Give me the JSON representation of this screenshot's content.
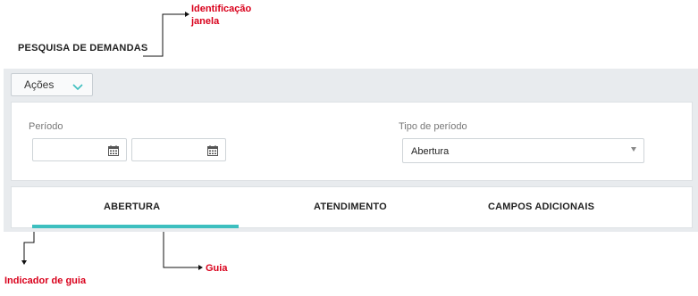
{
  "annotations": {
    "window_id": [
      "Identificação",
      "janela"
    ],
    "tab_indicator": "Indicador de guia",
    "tab": "Guia"
  },
  "page": {
    "title": "PESQUISA DE DEMANDAS"
  },
  "toolbar": {
    "actions_label": "Ações"
  },
  "filters": {
    "period_label": "Período",
    "period_start_value": "",
    "period_end_value": "",
    "period_type_label": "Tipo de período",
    "period_type_value": "Abertura"
  },
  "tabs": [
    {
      "label": "ABERTURA",
      "active": true
    },
    {
      "label": "ATENDIMENTO",
      "active": false
    },
    {
      "label": "CAMPOS ADICIONAIS",
      "active": false
    }
  ],
  "colors": {
    "accent": "#3dbfbf",
    "annotation": "#d9001b",
    "band": "#e8ebee"
  }
}
